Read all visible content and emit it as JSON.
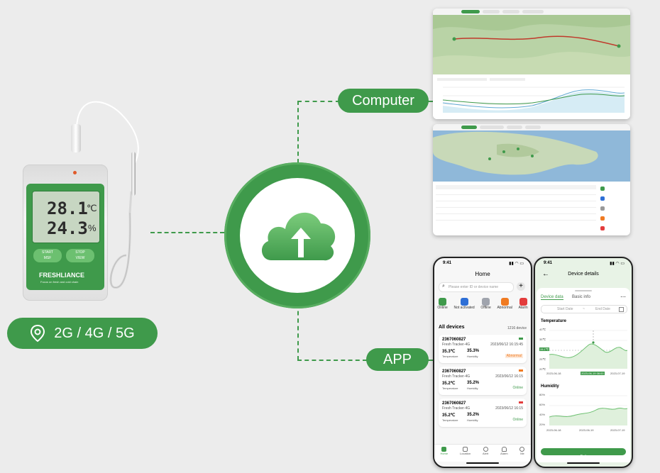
{
  "device": {
    "temperature": "28.1",
    "temp_unit": "℃",
    "humidity": "24.3",
    "hum_unit": "%",
    "start_label": "START",
    "start_sub": "MSF",
    "stop_label": "STOP",
    "stop_sub": "VIEW",
    "brand": "FRESHLIANCE",
    "tagline": "Focus on fresh and cold chain"
  },
  "network_badge": "2G / 4G / 5G",
  "labels": {
    "computer": "Computer",
    "app": "APP"
  },
  "colors": {
    "brand_green": "#3f9a4b",
    "light_green": "#6cc070",
    "dark_green": "#2f7d3a"
  },
  "icons": [
    "location-pin-icon",
    "cloud-upload-icon"
  ],
  "app_home": {
    "time": "9:41",
    "title": "Home",
    "search_placeholder": "Please enter ID or device name",
    "categories": [
      "Online",
      "Not activated",
      "Offline",
      "Abnormal",
      "Alarm"
    ],
    "section_title": "All devices",
    "section_count": "1216 device",
    "devices": [
      {
        "id": "2367060827",
        "model": "Fresh Tracker-4G",
        "date": "2023/06/12 16:15:45",
        "temp": "35.3℃",
        "temp_label": "Temperature",
        "hum": "35.3%",
        "hum_label": "Humidity",
        "status": "Abnormal"
      },
      {
        "id": "2367060827",
        "model": "Fresh Tracker-4G",
        "date": "2023/06/12 16:15",
        "temp": "35.2℃",
        "temp_label": "Temperature",
        "hum": "35.2%",
        "hum_label": "Humidity",
        "status": "Online"
      },
      {
        "id": "2367060827",
        "model": "Fresh Tracker-4G",
        "date": "2023/06/12 16:15",
        "temp": "35.2℃",
        "temp_label": "Temperature",
        "hum": "35.2%",
        "hum_label": "Humidity",
        "status": "Online"
      }
    ],
    "nav": [
      "Home",
      "Location",
      "Alert",
      "Alarm",
      "Me"
    ]
  },
  "app_details": {
    "time": "9:41",
    "title": "Device details",
    "tabs": [
      "Device data",
      "Basic info"
    ],
    "start_placeholder": "Start Date",
    "end_placeholder": "End Date",
    "temperature_title": "Temperature",
    "humidity_title": "Humidity",
    "temp_axis": [
      "40℃",
      "35℃",
      "30℃",
      "25℃",
      "20℃"
    ],
    "temp_tooltip": "28.1℃",
    "temp_x": [
      "2023-06-18",
      "2023-06-19 08:00",
      "2023-07-19"
    ],
    "hum_axis": [
      "80%",
      "60%",
      "40%",
      "20%"
    ],
    "hum_x": [
      "2023-06-18",
      "2023-06-19",
      "2023-07-19"
    ],
    "export_button": "Exit"
  }
}
